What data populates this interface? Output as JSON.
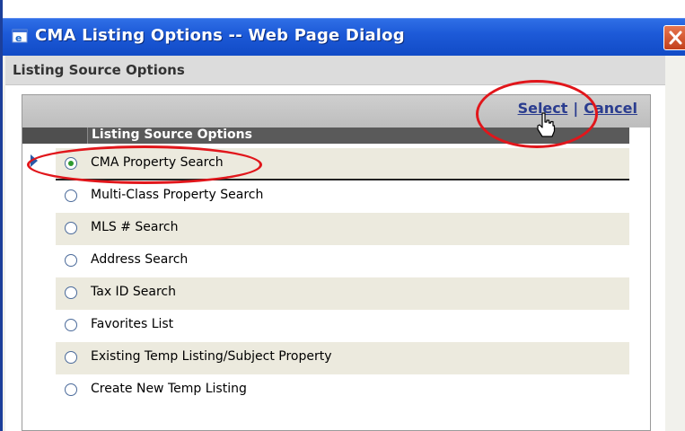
{
  "window": {
    "title": "CMA Listing Options -- Web Page Dialog"
  },
  "section": {
    "header": "Listing Source Options"
  },
  "actions": {
    "select_label": "Select",
    "separator": "|",
    "cancel_label": "Cancel"
  },
  "table": {
    "column_header": "Listing Source Options",
    "options": [
      {
        "label": "CMA Property Search",
        "checked": true
      },
      {
        "label": "Multi-Class Property Search",
        "checked": false
      },
      {
        "label": "MLS # Search",
        "checked": false
      },
      {
        "label": "Address Search",
        "checked": false
      },
      {
        "label": "Tax ID Search",
        "checked": false
      },
      {
        "label": "Favorites List",
        "checked": false
      },
      {
        "label": "Existing Temp Listing/Subject Property",
        "checked": false
      },
      {
        "label": "Create New Temp Listing",
        "checked": false
      }
    ]
  },
  "colors": {
    "titlebar": "#1d5ad8",
    "highlight_circle": "#e1161b",
    "link": "#2b3d8f",
    "radio_checked": "#2f9a2f"
  },
  "icons": [
    "ie-window-icon",
    "close-icon",
    "hand-cursor-icon",
    "row-indicator-icon"
  ]
}
